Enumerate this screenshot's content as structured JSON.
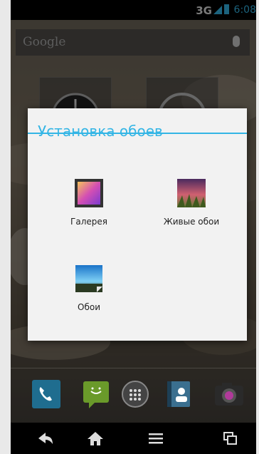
{
  "status_bar": {
    "network": "3G",
    "time": "6:08"
  },
  "search_bar": {
    "brand": "Google"
  },
  "dialog": {
    "title": "Установка обоев",
    "options": [
      {
        "label": "Галерея",
        "icon": "gallery-icon"
      },
      {
        "label": "Живые обои",
        "icon": "live-wallpaper-icon"
      },
      {
        "label": "Обои",
        "icon": "wallpaper-icon"
      }
    ]
  },
  "dock": {
    "items": [
      "phone-icon",
      "messaging-icon",
      "all-apps-icon",
      "contacts-icon",
      "camera-icon"
    ]
  },
  "nav_bar": {
    "items": [
      "back-icon",
      "home-icon",
      "menu-icon",
      "recent-apps-icon"
    ]
  },
  "colors": {
    "accent": "#33b5e5"
  }
}
